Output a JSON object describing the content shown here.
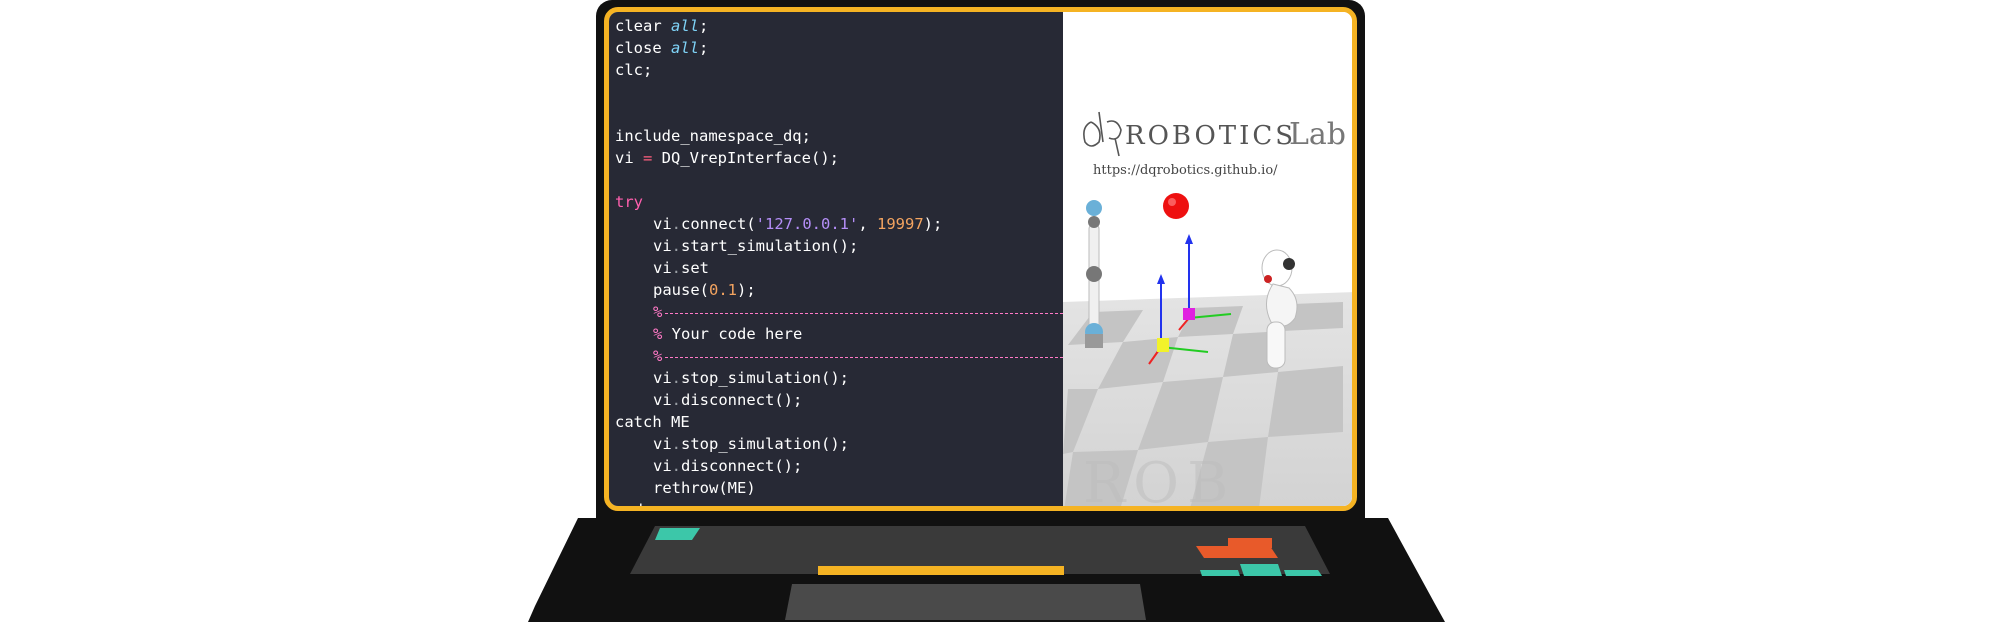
{
  "editor": {
    "lines": {
      "l1": {
        "a": "clear ",
        "b": "all",
        "c": ";"
      },
      "l2": {
        "a": "close ",
        "b": "all",
        "c": ";"
      },
      "l3": "clc;",
      "l4": "include_namespace_dq;",
      "l5": {
        "a": "vi ",
        "b": "=",
        "c": " DQ_VrepInterface();"
      },
      "l6": "try",
      "l7": {
        "a": "vi",
        "b": ".",
        "c": "connect(",
        "d": "'127.0.0.1'",
        "e": ", ",
        "f": "19997",
        "g": ");"
      },
      "l8": {
        "a": "vi",
        "b": ".",
        "c": "start_simulation();"
      },
      "l9": {
        "a": "vi",
        "b": ".",
        "c": "set"
      },
      "l10": {
        "a": "pause(",
        "b": "0.1",
        "c": ");"
      },
      "l11": "%",
      "l12": "% Your code here",
      "l13": "%",
      "l14": {
        "a": "vi",
        "b": ".",
        "c": "stop_simulation();"
      },
      "l15": {
        "a": "vi",
        "b": ".",
        "c": "disconnect();"
      },
      "l16": "catch ME",
      "l17": {
        "a": "vi",
        "b": ".",
        "c": "stop_simulation();"
      },
      "l18": {
        "a": "vi",
        "b": ".",
        "c": "disconnect();"
      },
      "l19": "rethrow(ME)",
      "l20": "end"
    }
  },
  "sim": {
    "logo_text": "ROBOTICS",
    "lab_text": "Lab",
    "url": "https://dqrobotics.github.io/",
    "watermark": "ROB"
  },
  "colors": {
    "frame": "#f5b323",
    "editor_bg": "#272935",
    "key_teal": "#3cc7a9",
    "key_yellow": "#f5b323",
    "key_orange": "#e85a2a"
  }
}
